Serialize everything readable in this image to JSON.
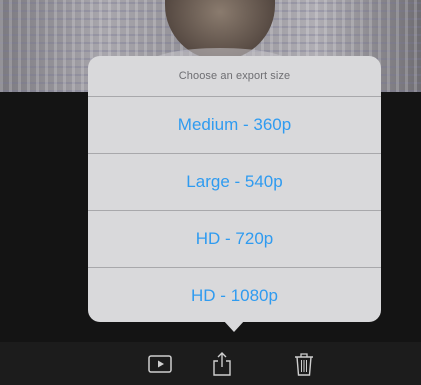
{
  "sheet": {
    "title": "Choose an export size",
    "options": [
      {
        "label": "Medium - 360p"
      },
      {
        "label": "Large - 540p"
      },
      {
        "label": "HD - 720p"
      },
      {
        "label": "HD - 1080p"
      }
    ]
  },
  "toolbar": {
    "icons": [
      "play-icon",
      "share-icon",
      "trash-icon"
    ]
  },
  "colors": {
    "accent": "#2f9bf0",
    "sheet_bg": "#d9d9db",
    "background": "#141414"
  }
}
